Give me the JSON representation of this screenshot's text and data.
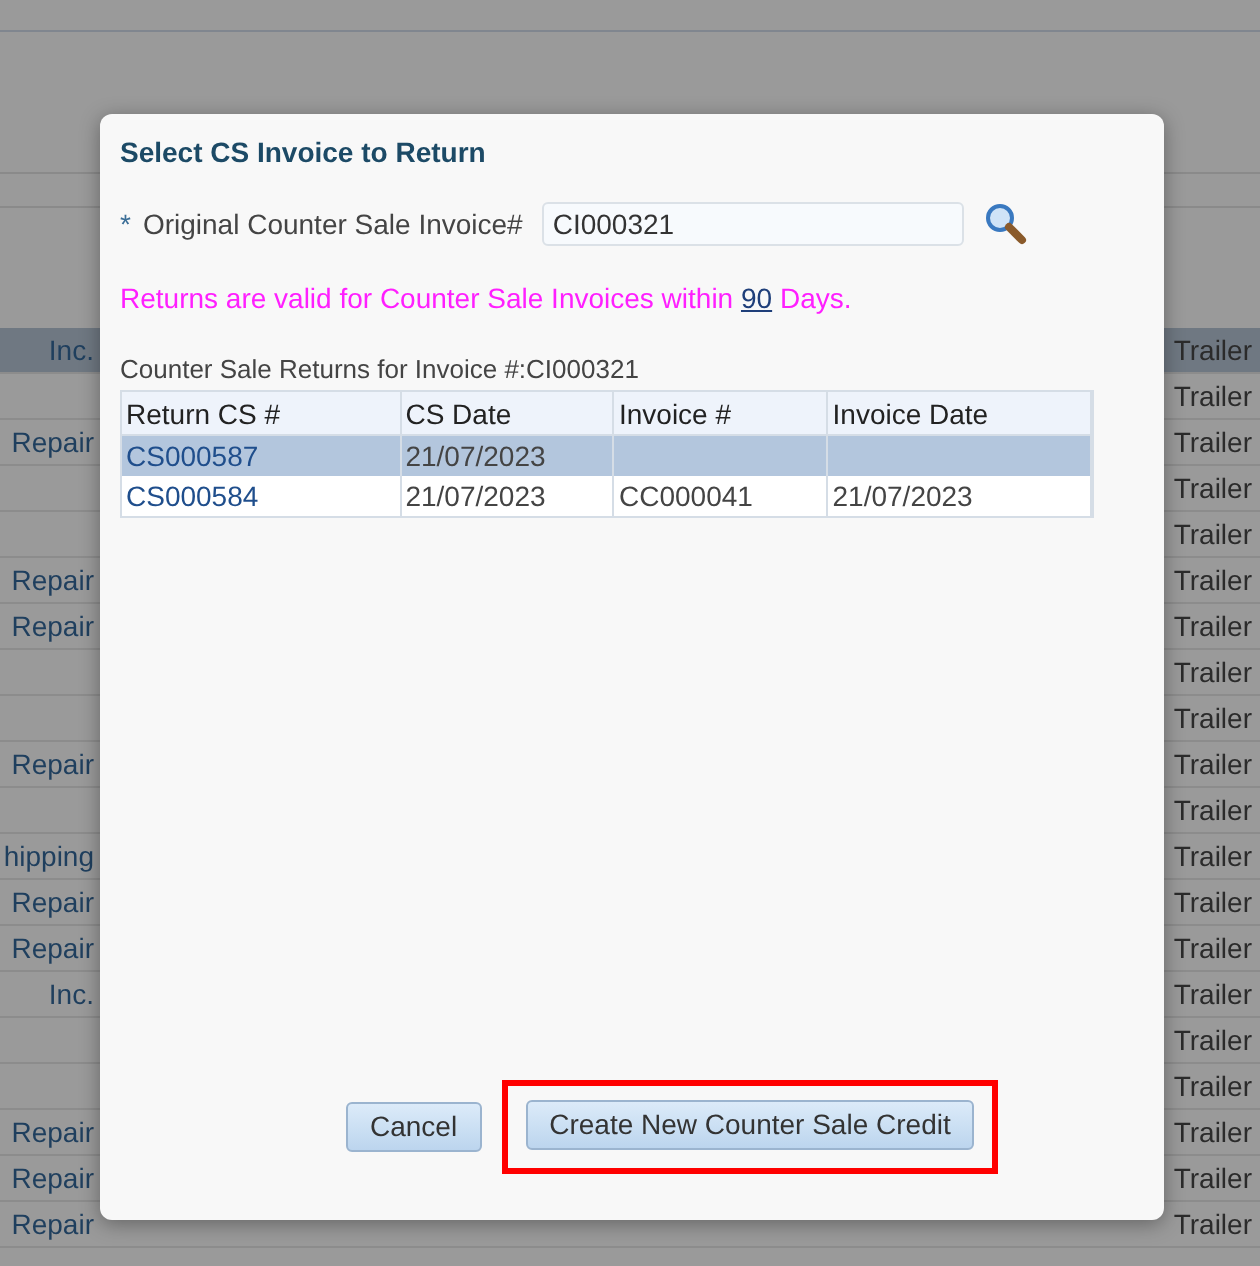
{
  "background_rows": [
    {
      "column_1": "Inc.",
      "column_2": "Trailer",
      "selected": true
    },
    {
      "column_2": "Trailer",
      "selected": false
    },
    {
      "column_1": "Repair",
      "column_2": "Trailer",
      "selected": false
    },
    {
      "column_2": "Trailer",
      "selected": false
    },
    {
      "column_2": "Trailer",
      "selected": false
    },
    {
      "column_1": "Repair",
      "column_2": "Trailer",
      "selected": false
    },
    {
      "column_1": "Repair",
      "column_2": "Trailer",
      "selected": false
    },
    {
      "column_2": "Trailer",
      "selected": false
    },
    {
      "column_2": "Trailer",
      "selected": false
    },
    {
      "column_1": "Repair",
      "column_2": "Trailer",
      "selected": false
    },
    {
      "column_2": "Trailer",
      "selected": false
    },
    {
      "column_1": "hipping",
      "column_2": "Trailer",
      "selected": false
    },
    {
      "column_1": "Repair",
      "column_2": "Trailer",
      "selected": false
    },
    {
      "column_1": "Repair",
      "column_2": "Trailer",
      "selected": false
    },
    {
      "column_1": "Inc.",
      "column_2": "Trailer",
      "selected": false
    },
    {
      "column_2": "Trailer",
      "selected": false
    },
    {
      "column_2": "Trailer",
      "selected": false
    },
    {
      "column_1": "Repair",
      "column_2": "Trailer",
      "selected": false
    },
    {
      "column_1": "Repair",
      "column_2": "Trailer",
      "selected": false
    },
    {
      "column_1": "Repair",
      "column_2": "Trailer",
      "selected": false
    }
  ],
  "dialog": {
    "title": "Select CS Invoice to Return",
    "field": {
      "required_mark": "*",
      "label": "Original Counter Sale Invoice#",
      "value": "CI000321"
    },
    "notice": {
      "before": "Returns are valid for Counter Sale Invoices within",
      "link": "90",
      "after": "Days."
    },
    "table": {
      "caption": "Counter Sale Returns for Invoice #:CI000321",
      "columns": [
        "Return CS #",
        "CS Date",
        "Invoice #",
        "Invoice Date"
      ],
      "rows": [
        {
          "selected": true,
          "cells": [
            "CS000587",
            "21/07/2023",
            "",
            ""
          ]
        },
        {
          "selected": false,
          "cells": [
            "CS000584",
            "21/07/2023",
            "CC000041",
            "21/07/2023"
          ]
        }
      ]
    },
    "buttons": [
      {
        "label": "Cancel",
        "highlighted": false
      },
      {
        "label": "Create New Counter Sale Credit",
        "highlighted": true
      }
    ]
  }
}
